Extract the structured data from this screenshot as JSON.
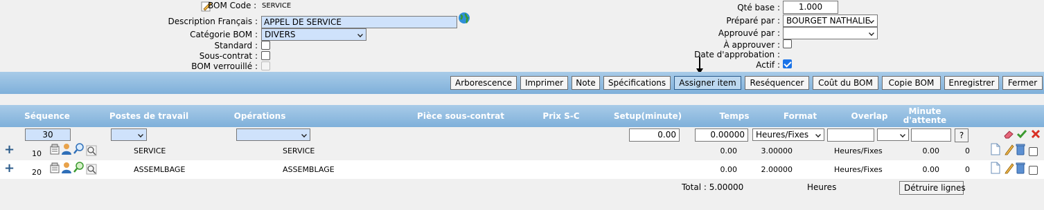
{
  "header": {
    "bom_code_label": "BOM Code :",
    "bom_code_value": "SERVICE",
    "description_label": "Description Français :",
    "description_value": "APPEL DE SERVICE",
    "categorie_label": "Catégorie BOM :",
    "categorie_value": "DIVERS",
    "standard_label": "Standard :",
    "sous_contrat_label": "Sous-contrat :",
    "bom_verrouille_label": "BOM verrouillé :",
    "qte_base_label": "Qté base :",
    "qte_base_value": "1.000",
    "prepare_label": "Préparé par :",
    "prepare_value": "BOURGET NATHALIE",
    "approuve_label": "Approuvé par :",
    "approuve_value": "",
    "a_approuver_label": "À approuver :",
    "date_approbation_label": "Date d'approbation :",
    "actif_label": "Actif :",
    "actif_checked": true
  },
  "toolbar": {
    "buttons": [
      "Arborescence",
      "Imprimer",
      "Note",
      "Spécifications",
      "Assigner item",
      "Reséquencer",
      "Coût du BOM",
      "Copie BOM",
      "Enregistrer",
      "Fermer"
    ]
  },
  "grid": {
    "columns": [
      "Séquence",
      "Postes de travail",
      "Opérations",
      "Pièce sous-contrat",
      "Prix S-C",
      "Setup(minute)",
      "Temps",
      "Format",
      "Overlap",
      "Minute",
      "d'attente"
    ],
    "new_row": {
      "sequence": "30",
      "setup": "0.00",
      "temps": "0.00000",
      "format": "Heures/Fixes",
      "help": "?"
    },
    "rows": [
      {
        "seq": "10",
        "poste": "SERVICE",
        "operation": "SERVICE",
        "setup": "0.00",
        "temps": "3.00000",
        "format": "Heures/Fixes",
        "attente": "0.00",
        "overlap": "0"
      },
      {
        "seq": "20",
        "poste": "ASSEMLBAGE",
        "operation": "ASSEMBLAGE",
        "setup": "0.00",
        "temps": "2.00000",
        "format": "Heures/Fixes",
        "attente": "0.00",
        "overlap": "0"
      }
    ],
    "total_label": "Total : 5.00000",
    "total_unit": "Heures",
    "delete_lines_label": "Détruire lignes"
  },
  "colors": {
    "bar": "#8fbbe0",
    "input_blue": "#cfe2fb",
    "accent": "#2b5b8a"
  }
}
